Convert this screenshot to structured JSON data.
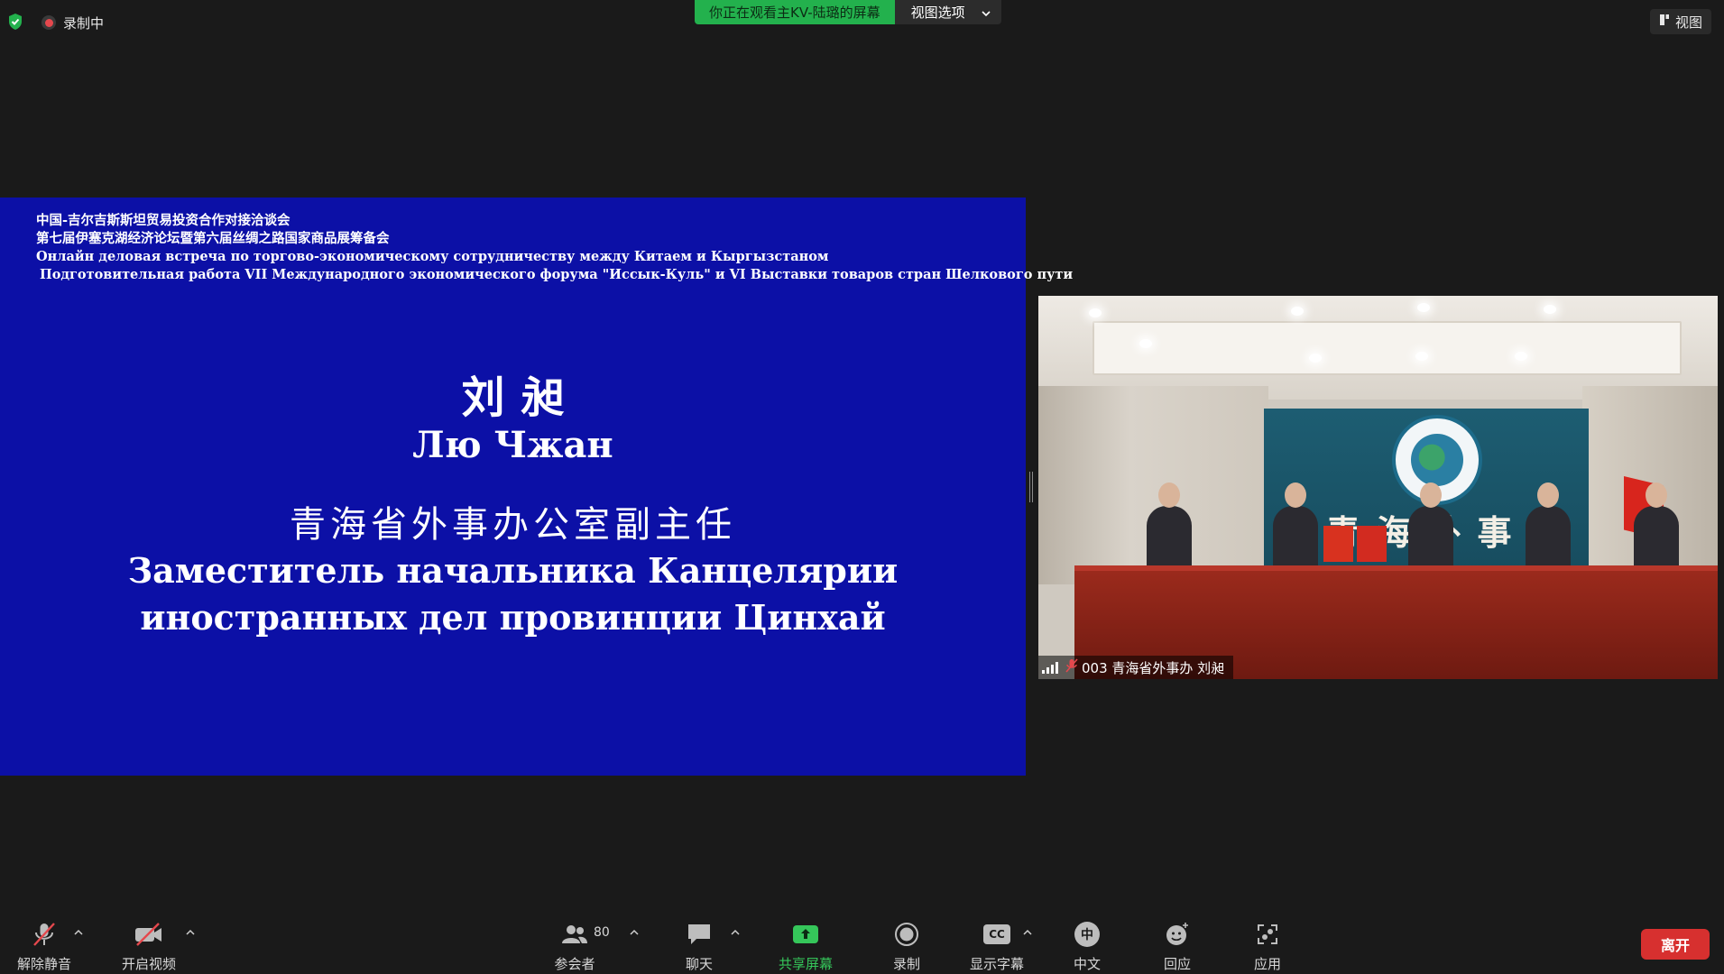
{
  "top": {
    "recording_label": "录制中",
    "viewing_text": "你正在观看主KV-陆璐的屏幕",
    "view_options_label": "视图选项",
    "view_button_label": "视图"
  },
  "slide": {
    "header_lines": [
      "中国-吉尔吉斯斯坦贸易投资合作对接洽谈会",
      "第七届伊塞克湖经济论坛暨第六届丝绸之路国家商品展筹备会",
      "Онлайн деловая встреча по торгово-экономическому сотрудничеству между Китаем и Кыргызстаном",
      "Подготовительная работа VII Международного экономического форума \"Иссык-Куль\" и VI Выставки товаров стран Шелкового пути"
    ],
    "name_cn": "刘昶",
    "name_ru": "Лю Чжан",
    "title_cn": "青海省外事办公室副主任",
    "title_ru_line1": "Заместитель начальника Канцелярии",
    "title_ru_line2": "иностранных дел провинции Цинхай"
  },
  "video": {
    "sign_text": "青海外事",
    "caption": "003 青海省外事办 刘昶"
  },
  "toolbar": {
    "unmute": "解除静音",
    "start_video": "开启视频",
    "participants": "参会者",
    "participants_count": "80",
    "chat": "聊天",
    "share_screen": "共享屏幕",
    "record": "录制",
    "captions": "显示字幕",
    "cc_badge": "CC",
    "language": "中文",
    "language_badge": "中",
    "reactions": "回应",
    "apps": "应用",
    "leave": "离开"
  },
  "colors": {
    "slide_bg": "#0c10a6",
    "share_green": "#23b14d",
    "leave_red": "#d7302f",
    "window_bg": "#1a1a1a"
  }
}
